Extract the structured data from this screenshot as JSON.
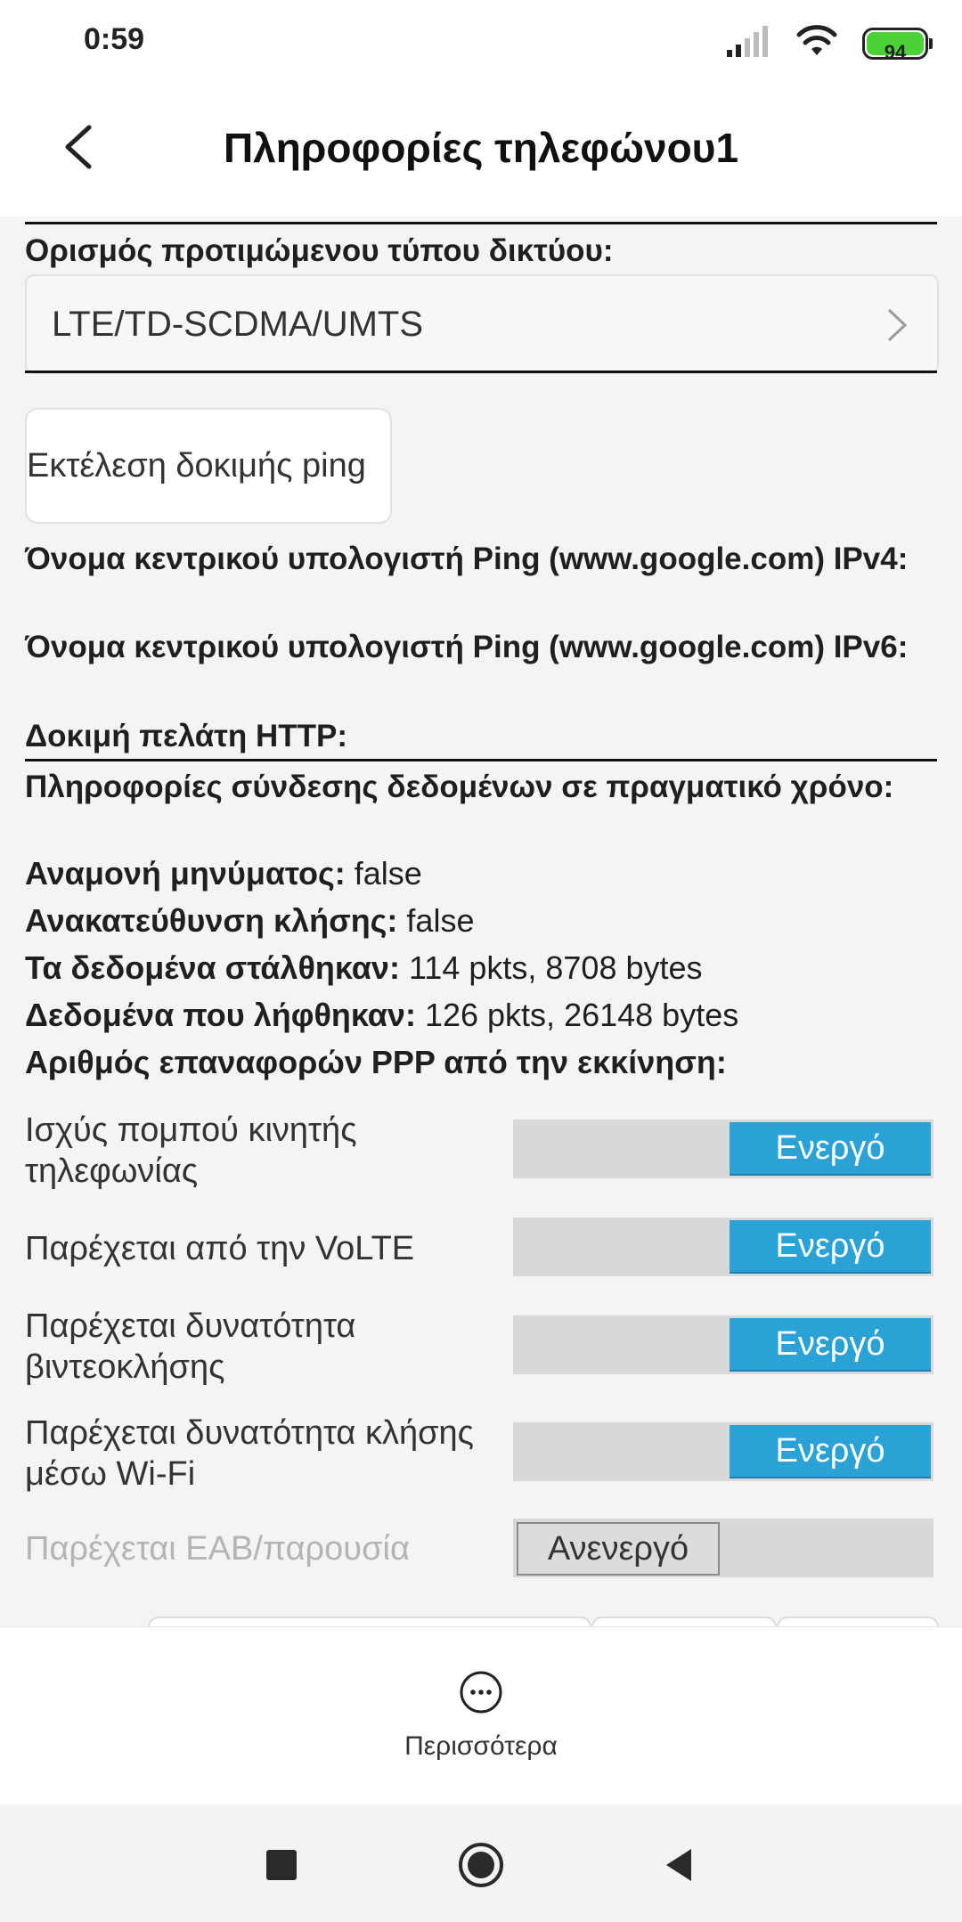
{
  "status_bar": {
    "time": "0:59",
    "battery": "94"
  },
  "header": {
    "title": "Πληροφορίες τηλεφώνου1"
  },
  "network": {
    "label": "Ορισμός προτιμώμενου τύπου δικτύου:",
    "value": "LTE/TD-SCDMA/UMTS"
  },
  "ping": {
    "button": "Εκτέλεση δοκιμής ping",
    "ipv4_label": "Όνομα κεντρικού υπολογιστή Ping (www.google.com) IPv4:",
    "ipv6_label": "Όνομα κεντρικού υπολογιστή Ping (www.google.com) IPv6:",
    "http_label": "Δοκιμή πελάτη HTTP:"
  },
  "data_info": {
    "heading": "Πληροφορίες σύνδεσης δεδομένων σε πραγματικό χρόνο:",
    "rows": [
      {
        "label": "Αναμονή μηνύματος:",
        "value": "false"
      },
      {
        "label": "Ανακατεύθυνση κλήσης:",
        "value": "false"
      },
      {
        "label": "Τα δεδομένα στάλθηκαν:",
        "value": "114 pkts, 8708 bytes"
      },
      {
        "label": "Δεδομένα που λήφθηκαν:",
        "value": "126 pkts, 26148 bytes"
      },
      {
        "label": "Αριθμός επαναφορών PPP από την εκκίνηση:",
        "value": ""
      }
    ]
  },
  "toggles": [
    {
      "label": "Ισχύς πομπού κινητής τηλεφωνίας",
      "state": "Ενεργό",
      "enabled": true
    },
    {
      "label": "Παρέχεται από την VoLTE",
      "state": "Ενεργό",
      "enabled": true
    },
    {
      "label": "Παρέχεται δυνατότητα βιντεοκλήσης",
      "state": "Ενεργό",
      "enabled": true
    },
    {
      "label": "Παρέχεται δυνατότητα κλήσης μέσω Wi-Fi",
      "state": "Ενεργό",
      "enabled": true
    },
    {
      "label": "Παρέχεται EAB/παρουσία",
      "state": "Ανενεργό",
      "enabled": false
    }
  ],
  "action_bar": {
    "more_label": "Περισσότερα"
  },
  "colors": {
    "accent": "#2ba2d6",
    "toggle_track": "#d8d8d8",
    "background": "#f4f4f4"
  }
}
